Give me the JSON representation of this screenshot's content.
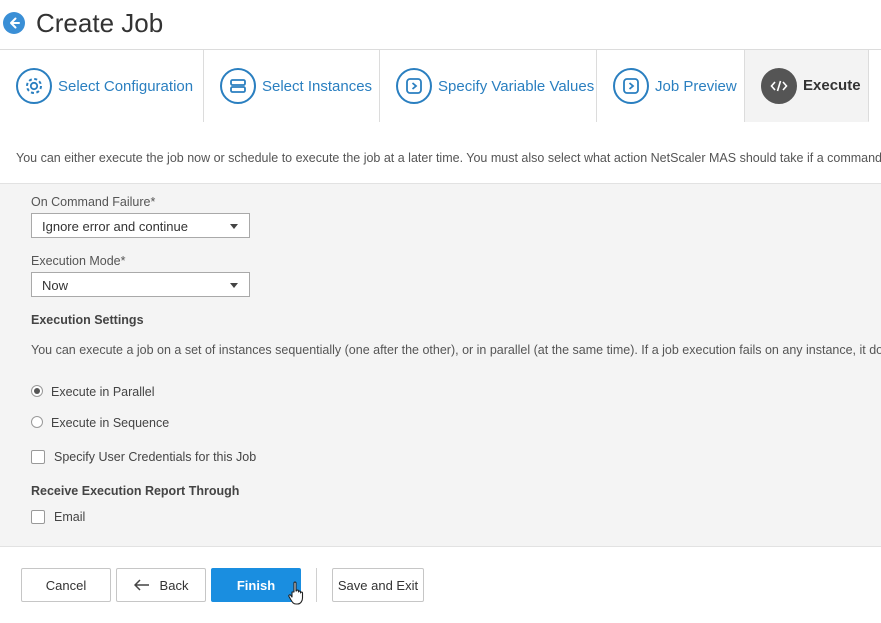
{
  "header": {
    "title": "Create Job"
  },
  "wizard": {
    "steps": [
      {
        "label": "Select Configuration",
        "icon": "gear-icon"
      },
      {
        "label": "Select Instances",
        "icon": "server-icon"
      },
      {
        "label": "Specify Variable Values",
        "icon": "chevron-right-icon"
      },
      {
        "label": "Job Preview",
        "icon": "chevron-right-icon"
      },
      {
        "label": "Execute",
        "icon": "code-icon",
        "active": true
      }
    ]
  },
  "intro": "You can either execute the job now or schedule to execute the job at a later time. You must also select what action NetScaler MAS should take if a command fai",
  "form": {
    "on_command_failure": {
      "label": "On Command Failure*",
      "value": "Ignore error and continue"
    },
    "execution_mode": {
      "label": "Execution Mode*",
      "value": "Now"
    },
    "execution_settings": {
      "title": "Execution Settings",
      "description": "You can execute a job on a set of instances sequentially (one after the other), or in parallel (at the same time). If a job execution fails on any instance, it does n",
      "options": [
        {
          "label": "Execute in Parallel",
          "checked": true
        },
        {
          "label": "Execute in Sequence",
          "checked": false
        }
      ],
      "user_credentials": {
        "label": "Specify User Credentials for this Job",
        "checked": false
      }
    },
    "report": {
      "title": "Receive Execution Report Through",
      "email": {
        "label": "Email",
        "checked": false
      }
    }
  },
  "footer": {
    "cancel": "Cancel",
    "back": "Back",
    "finish": "Finish",
    "save_exit": "Save and Exit"
  },
  "colors": {
    "accent": "#2a7fc0",
    "primary_button": "#1a8ee0",
    "panel_bg": "#f4f4f4"
  }
}
